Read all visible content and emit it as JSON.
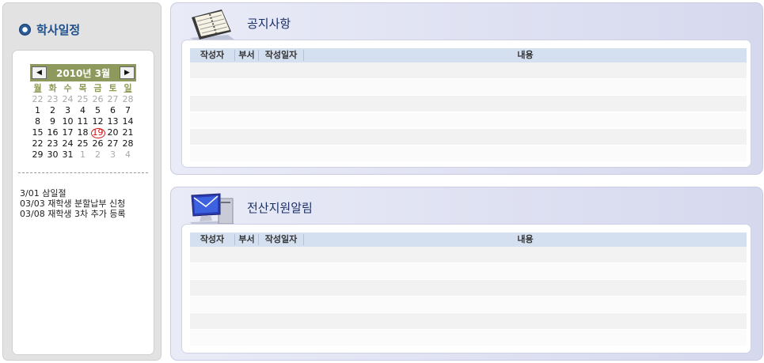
{
  "left": {
    "title": "학사일정",
    "calendar": {
      "month_label": "2010년 3월",
      "prev_icon": "◀",
      "next_icon": "▶",
      "weekdays": [
        "월",
        "화",
        "수",
        "목",
        "금",
        "토",
        "일"
      ],
      "days": [
        [
          "22",
          "23",
          "24",
          "25",
          "26",
          "27",
          "28"
        ],
        [
          "1",
          "2",
          "3",
          "4",
          "5",
          "6",
          "7"
        ],
        [
          "8",
          "9",
          "10",
          "11",
          "12",
          "13",
          "14"
        ],
        [
          "15",
          "16",
          "17",
          "18",
          "19",
          "20",
          "21"
        ],
        [
          "22",
          "23",
          "24",
          "25",
          "26",
          "27",
          "28"
        ],
        [
          "29",
          "30",
          "31",
          "1",
          "2",
          "3",
          "4"
        ]
      ],
      "today": "19"
    },
    "events": [
      "3/01 삼일절",
      "03/03 재학생 분할납부 신청",
      "03/08 재학생 3차 추가 등록"
    ]
  },
  "notice": {
    "title": "공지사항",
    "icon": "notebook-icon",
    "columns": [
      "작성자",
      "부서",
      "작성일자",
      "내용"
    ],
    "rows": 6
  },
  "it_notice": {
    "title": "전산지원알림",
    "icon": "computer-icon",
    "columns": [
      "작성자",
      "부서",
      "작성일자",
      "내용"
    ],
    "rows": 6
  },
  "colors": {
    "calendar_header": "#8e9a5d",
    "title_blue": "#1e4f8a",
    "table_header": "#d4dff0",
    "today_circle": "#d42020"
  }
}
